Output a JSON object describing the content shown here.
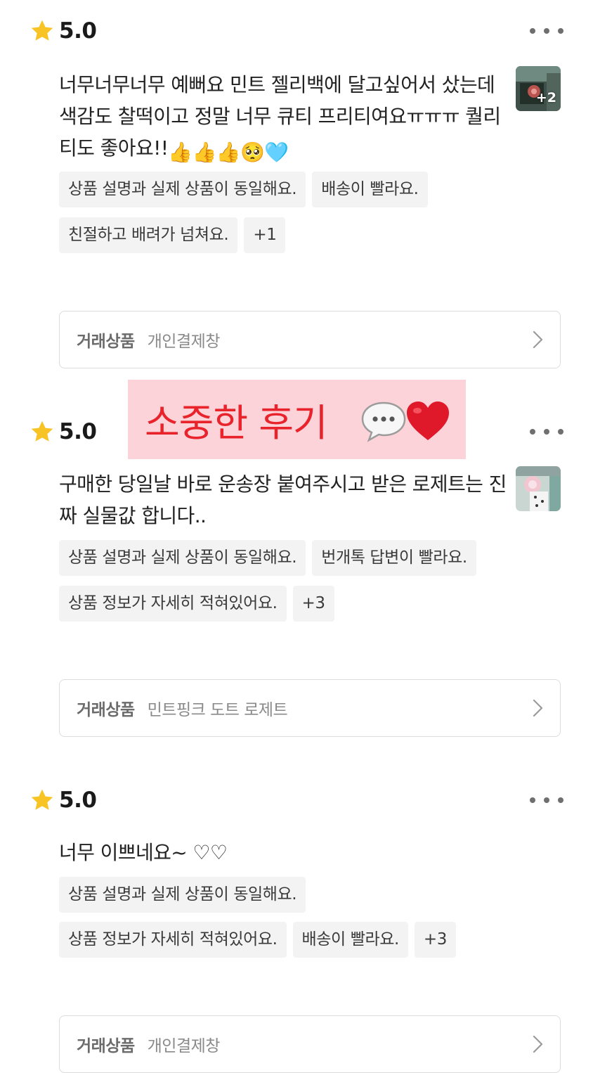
{
  "reviews": [
    {
      "rating": "5.0",
      "text": "너무너무너무 예뻐요 민트 젤리백에 달고싶어서 샀는데 색감도 찰떡이고 정말 너무 큐티 프리티여요ㅠㅠㅠ 퀄리티도 좋아요!!",
      "text_emoji": "👍👍👍🥺🩵",
      "photo_count": "+2",
      "tags": [
        "상품 설명과 실제 상품이 동일해요.",
        "배송이 빨라요.",
        "친절하고 배려가 넘쳐요.",
        "+1"
      ],
      "product_label": "거래상품",
      "product_name": "개인결제창"
    },
    {
      "rating": "5.0",
      "text": "구매한 당일날 바로 운송장 붙여주시고 받은 로제트는 진짜 실물값 합니다..",
      "tags": [
        "상품 설명과 실제 상품이 동일해요.",
        "번개톡 답변이 빨라요.",
        "상품 정보가 자세히 적혀있어요.",
        "+3"
      ],
      "product_label": "거래상품",
      "product_name": "민트핑크 도트 로제트"
    },
    {
      "rating": "5.0",
      "text": "너무 이쁘네요~ ♡♡",
      "tags": [
        "상품 설명과 실제 상품이 동일해요.",
        "상품 정보가 자세히 적혀있어요.",
        "배송이 빨라요.",
        "+3"
      ],
      "product_label": "거래상품",
      "product_name": "개인결제창"
    }
  ],
  "banner": {
    "text": "소중한 후기",
    "icons": [
      "speech-bubble-icon",
      "red-heart-icon"
    ],
    "background": "#fcd3d8",
    "text_color": "#e8232c"
  },
  "icons": {
    "rating": "star-icon",
    "more": "more-options-icon",
    "chevron": "chevron-right-icon"
  },
  "colors": {
    "star": "#f7c325",
    "tag_bg": "#f3f3f3",
    "box_border": "#dcdcdc"
  }
}
